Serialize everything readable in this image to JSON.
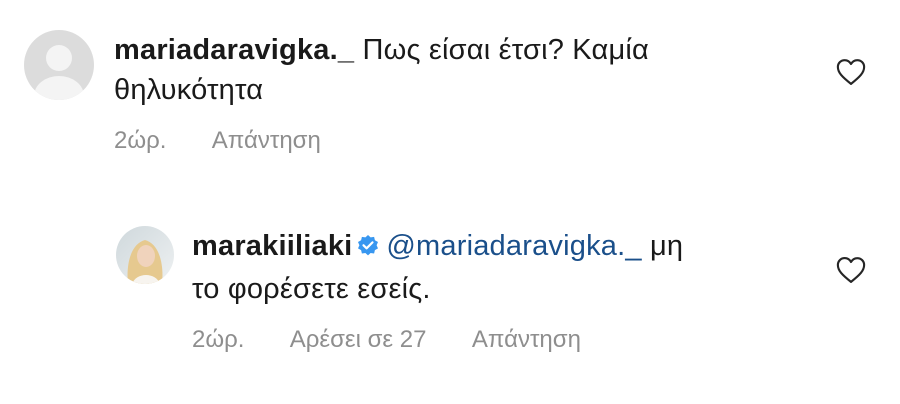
{
  "comments": [
    {
      "username": "mariadaravigka._",
      "text_line1": "Πως είσαι έτσι? Καμία",
      "text_line2": "θηλυκότητα",
      "time": "2ώρ.",
      "reply_label": "Απάντηση",
      "avatar": "default-avatar",
      "like_icon": "heart-outline-icon"
    },
    {
      "username": "marakiiliaki",
      "verified": "verified-badge-icon",
      "mention": "@mariadaravigka._",
      "text_line1": "μη",
      "text_line2": "το φορέσετε εσείς.",
      "time": "2ώρ.",
      "likes_label": "Αρέσει σε 27",
      "reply_label": "Απάντηση",
      "avatar": "profile-photo",
      "like_icon": "heart-outline-icon"
    }
  ],
  "colors": {
    "username": "#1a1a1a",
    "mention": "#1a4f8a",
    "meta": "#8e8e8e",
    "verified": "#3897f0",
    "avatar_default": "#dbdbdb"
  }
}
